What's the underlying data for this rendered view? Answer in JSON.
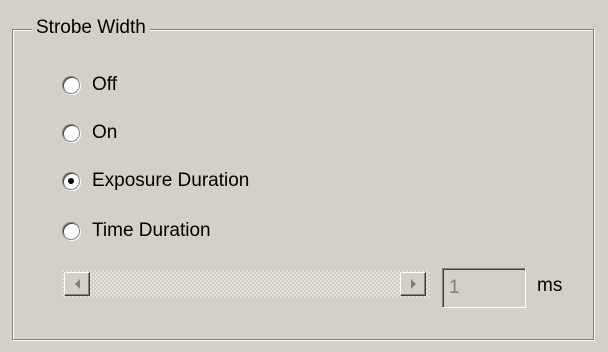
{
  "group": {
    "title": "Strobe Width"
  },
  "radios": [
    {
      "label": "Off",
      "checked": false
    },
    {
      "label": "On",
      "checked": false
    },
    {
      "label": "Exposure Duration",
      "checked": true
    },
    {
      "label": "Time Duration",
      "checked": false
    }
  ],
  "slider": {
    "value": "1",
    "unit": "ms"
  },
  "icons": {
    "left": "arrow-left-icon",
    "right": "arrow-right-icon"
  },
  "colors": {
    "face": "#d4d0c8",
    "shadow": "#808080",
    "highlight": "#ffffff"
  }
}
